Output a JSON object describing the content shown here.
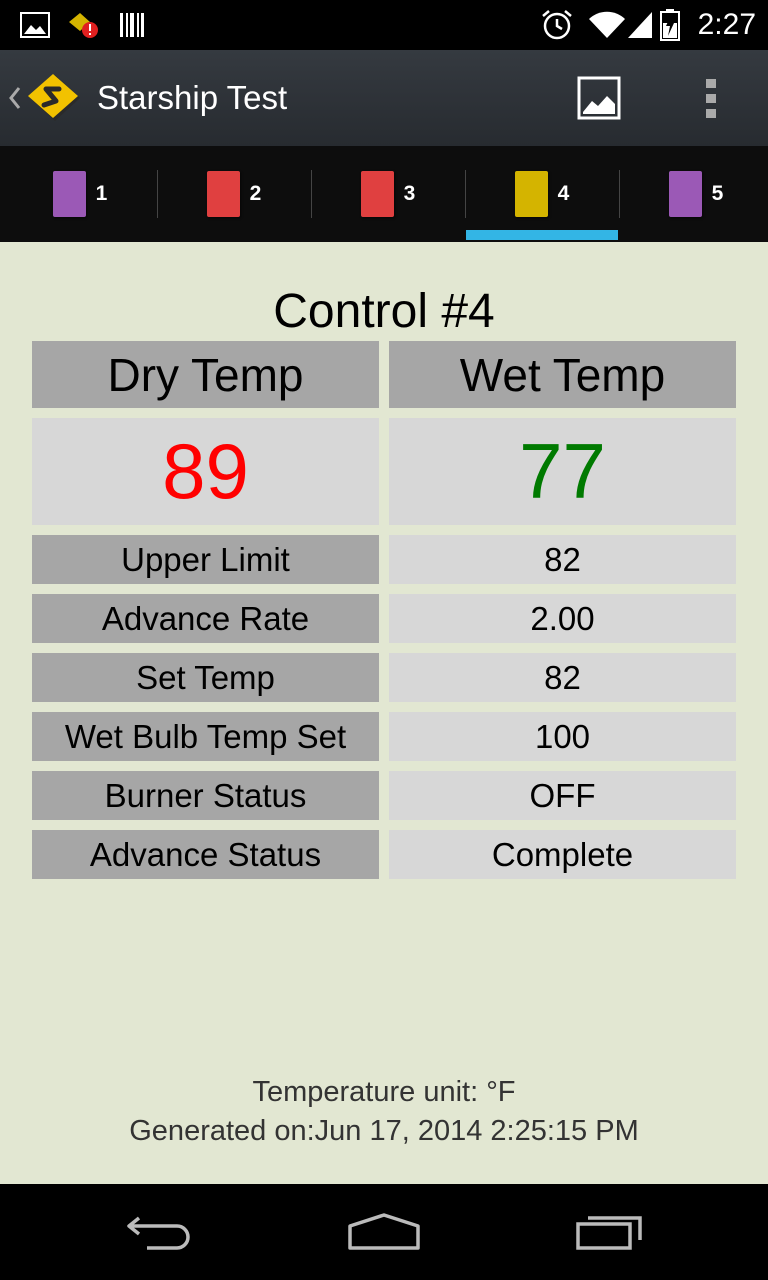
{
  "status_bar": {
    "time": "2:27",
    "icons": [
      "picture-notification-icon",
      "alert-notification-icon",
      "barcode-notification-icon",
      "alarm-icon",
      "wifi-icon",
      "signal-icon",
      "battery-charging-icon"
    ]
  },
  "action_bar": {
    "title": "Starship Test",
    "icons": [
      "up-caret-icon",
      "app-logo-icon",
      "image-icon",
      "overflow-menu-icon"
    ]
  },
  "tabs": [
    {
      "label": "1",
      "color": "#9b59b6"
    },
    {
      "label": "2",
      "color": "#e04040"
    },
    {
      "label": "3",
      "color": "#e04040"
    },
    {
      "label": "4",
      "color": "#d4b400"
    },
    {
      "label": "5",
      "color": "#9b59b6"
    }
  ],
  "selected_tab": "4",
  "colors": {
    "accent": "#33b5e5",
    "dry_value": "#ff0000",
    "wet_value": "#007a00",
    "background": "#e2e7d2"
  },
  "control": {
    "title": "Control #4",
    "dry_header": "Dry Temp",
    "wet_header": "Wet Temp",
    "dry_value": "89",
    "wet_value": "77",
    "rows": [
      {
        "label": "Upper Limit",
        "value": "82"
      },
      {
        "label": "Advance Rate",
        "value": "2.00"
      },
      {
        "label": "Set Temp",
        "value": "82"
      },
      {
        "label": "Wet Bulb Temp Set",
        "value": "100"
      },
      {
        "label": "Burner Status",
        "value": "OFF"
      },
      {
        "label": "Advance Status",
        "value": "Complete"
      }
    ]
  },
  "footer": {
    "unit_line": "Temperature unit: °F",
    "generated_line": "Generated on:Jun 17, 2014 2:25:15 PM"
  },
  "nav_bar": {
    "icons": [
      "back-icon",
      "home-icon",
      "recents-icon"
    ]
  }
}
